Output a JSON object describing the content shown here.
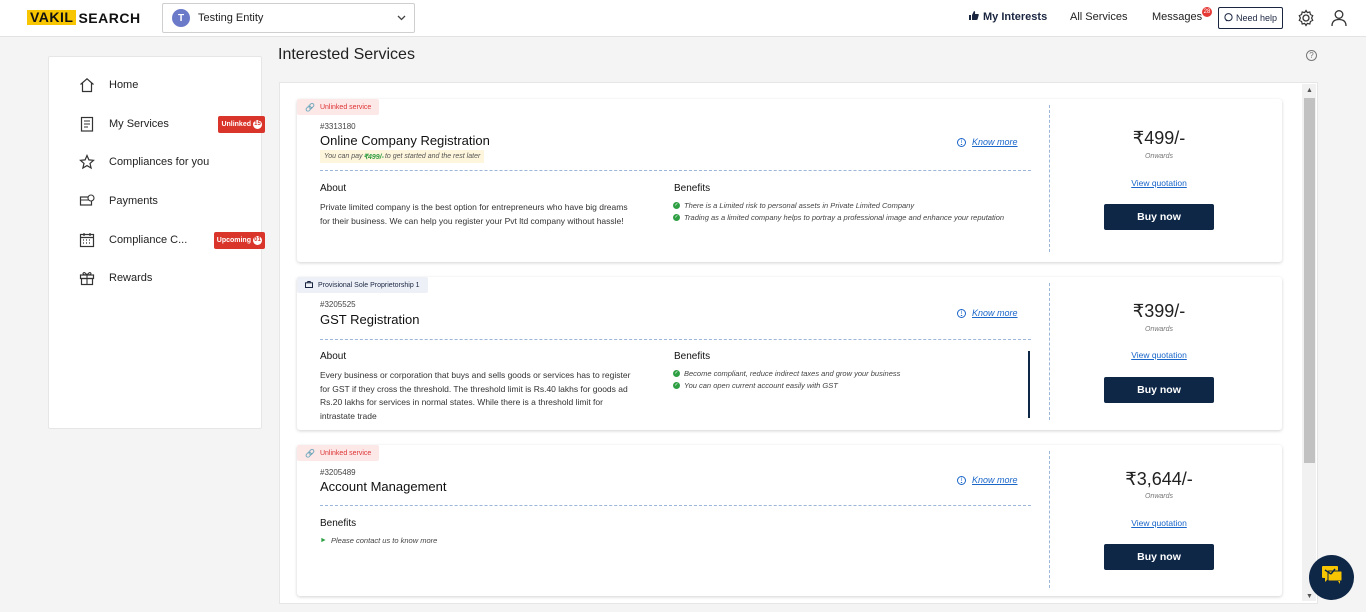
{
  "brand": {
    "part1": "VAKIL",
    "part2": "SEARCH"
  },
  "entity": {
    "initial": "T",
    "name": "Testing Entity"
  },
  "nav": {
    "my_interests": "My Interests",
    "all_services": "All Services",
    "messages": "Messages",
    "messages_count": "28",
    "need_help": "Need help"
  },
  "sidebar": {
    "items": [
      {
        "label": "Home",
        "icon": "home-icon"
      },
      {
        "label": "My Services",
        "icon": "services-icon",
        "badge": "Unlinked",
        "badge_count": "15"
      },
      {
        "label": "Compliances for you",
        "icon": "star-icon"
      },
      {
        "label": "Payments",
        "icon": "payments-icon"
      },
      {
        "label": "Compliance C...",
        "icon": "calendar-icon",
        "badge": "Upcoming",
        "badge_count": "01"
      },
      {
        "label": "Rewards",
        "icon": "gift-icon"
      }
    ]
  },
  "main": {
    "title": "Interested Services",
    "cards": [
      {
        "tag": "Unlinked service",
        "id": "#3313180",
        "title": "Online Company Registration",
        "pay_note_pre": "You can pay",
        "pay_note_amt": "₹499/-",
        "pay_note_post": "to get started and the rest later",
        "know_more": "Know more",
        "about_heading": "About",
        "about": "Private limited company is the best option for entrepreneurs who have big dreams for their business. We can help you register your Pvt ltd company without hassle!",
        "benefits_heading": "Benefits",
        "benefits": [
          "There is a Limited risk to personal assets in Private Limited Company",
          "Trading as a limited company helps to portray a professional image and enhance your reputation"
        ],
        "price": "₹499/-",
        "onwards": "Onwards",
        "view_quotation": "View quotation",
        "buy": "Buy now"
      },
      {
        "tag": "Provisional Sole Proprietorship 1",
        "id": "#3205525",
        "title": "GST Registration",
        "know_more": "Know more",
        "about_heading": "About",
        "about": "Every business or corporation that buys and sells goods or services has to register for GST if they cross the threshold. The threshold limit is Rs.40 lakhs for goods ad Rs.20 lakhs for services in normal states. While there is a threshold limit for intrastate trade",
        "benefits_heading": "Benefits",
        "benefits": [
          "Become compliant, reduce indirect taxes and grow your business",
          "You can open current account easily with GST"
        ],
        "price": "₹399/-",
        "onwards": "Onwards",
        "view_quotation": "View quotation",
        "buy": "Buy now"
      },
      {
        "tag": "Unlinked service",
        "id": "#3205489",
        "title": "Account Management",
        "know_more": "Know more",
        "benefits_heading": "Benefits",
        "benefits": [
          "Please contact us to know more"
        ],
        "price": "₹3,644/-",
        "onwards": "Onwards",
        "view_quotation": "View quotation",
        "buy": "Buy now"
      }
    ]
  },
  "colors": {
    "accent": "#0e2747",
    "brand_yellow": "#f7c600",
    "badge_red": "#d9352b",
    "link": "#1a66c9"
  }
}
